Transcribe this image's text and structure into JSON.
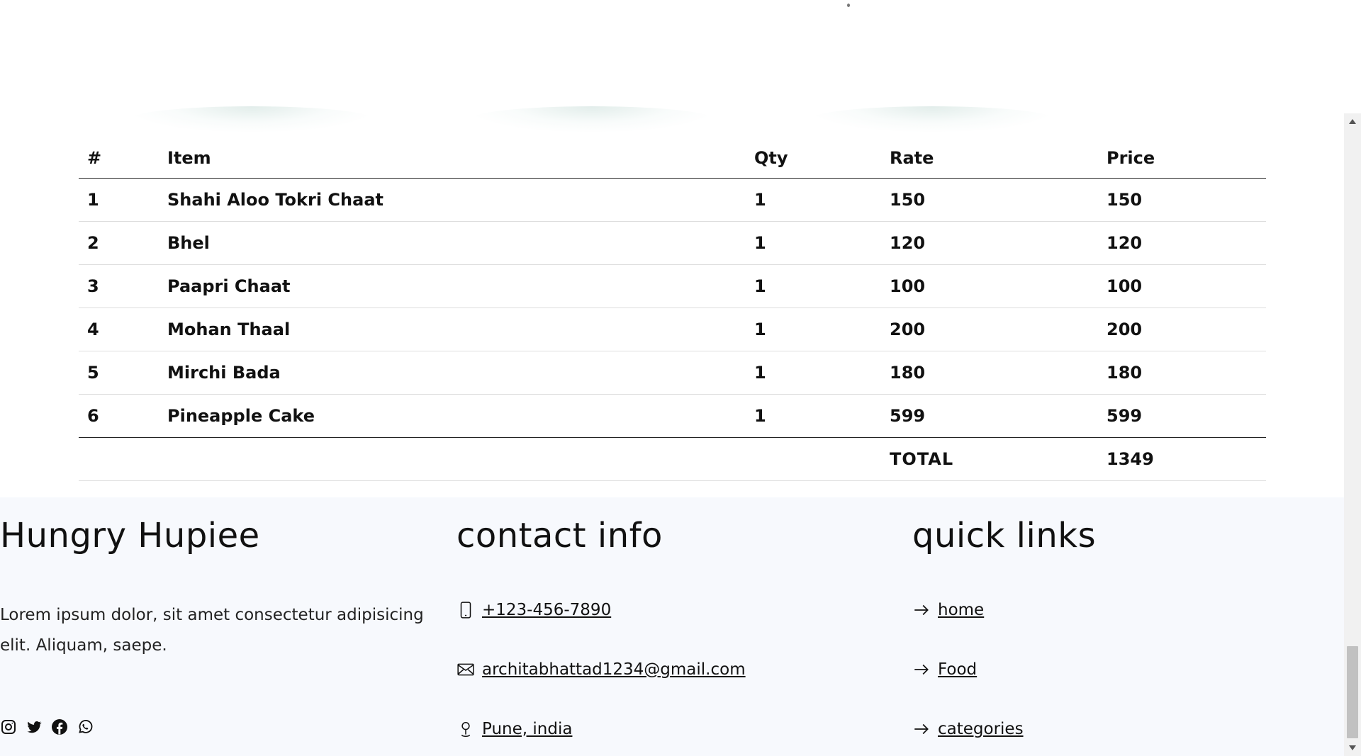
{
  "order_table": {
    "headers": [
      "#",
      "Item",
      "Qty",
      "Rate",
      "Price"
    ],
    "rows": [
      {
        "num": "1",
        "item": "Shahi Aloo Tokri Chaat",
        "qty": "1",
        "rate": "150",
        "price": "150"
      },
      {
        "num": "2",
        "item": "Bhel",
        "qty": "1",
        "rate": "120",
        "price": "120"
      },
      {
        "num": "3",
        "item": "Paapri Chaat",
        "qty": "1",
        "rate": "100",
        "price": "100"
      },
      {
        "num": "4",
        "item": "Mohan Thaal",
        "qty": "1",
        "rate": "200",
        "price": "200"
      },
      {
        "num": "5",
        "item": "Mirchi Bada",
        "qty": "1",
        "rate": "180",
        "price": "180"
      },
      {
        "num": "6",
        "item": "Pineapple Cake",
        "qty": "1",
        "rate": "599",
        "price": "599"
      }
    ],
    "total_label": "TOTAL",
    "total_value": "1349"
  },
  "footer": {
    "brand": {
      "title": "Hungry Hupiee",
      "about": "Lorem ipsum dolor, sit amet consectetur adipisicing elit. Aliquam, saepe.",
      "socials": [
        "instagram-icon",
        "twitter-icon",
        "facebook-icon",
        "whatsapp-icon"
      ]
    },
    "contact": {
      "title": "contact info",
      "phone": " +123-456-7890",
      "email": " architabhattad1234@gmail.com",
      "location": " Pune, india"
    },
    "links": {
      "title": "quick links",
      "items": [
        " home",
        " Food",
        " categories"
      ]
    }
  },
  "colors": {
    "footer_bg": "#f7f9fd",
    "text": "#111111"
  }
}
